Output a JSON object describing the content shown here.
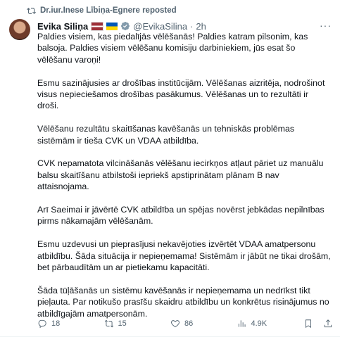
{
  "repost": {
    "text": "Dr.iur.Inese Lībiņa-Egnere reposted"
  },
  "author": {
    "name": "Evika Siliņa",
    "handle": "@EvikaSilina",
    "separator": "·",
    "time": "2h"
  },
  "tweet": {
    "paragraphs": [
      "Paldies visiem, kas piedalījās vēlēšanās! Paldies katram pilsonim, kas balsoja. Paldies visiem vēlēšanu komisiju darbiniekiem, jūs esat šo vēlēšanu varoņi!",
      "Esmu sazinājusies ar drošības institūcijām. Vēlēšanas aizritēja, nodrošinot visus nepieciešamos drošības pasākumus. Vēlēšanas un to rezultāti ir droši.",
      "Vēlēšanu rezultātu skaitīšanas kavēšanās un tehniskās problēmas sistēmām ir tieša CVK un VDAA atbildība.",
      "CVK nepamatota vilcināšanās vēlēšanu iecirkņos atļaut pāriet uz manuālu balsu skaitīšanu atbilstoši iepriekš apstiprinātam plānam B nav attaisnojama.",
      "Arī Saeimai ir jāvērtē CVK atbildība un spējas novērst jebkādas nepilnības pirms nākamajām vēlēšanām.",
      "Esmu uzdevusi un pieprasījusi nekavējoties izvērtēt VDAA amatpersonu atbildību. Šāda situācija ir nepieņemama! Sistēmām ir jābūt ne tikai drošām, bet pārbaudītām un ar pietiekamu kapacitāti.",
      "Šāda tūļāšanās un sistēmu kavēšanās ir nepieņemama un nedrīkst tikt pieļauta. Par notikušo prasīšu skaidru atbildību un konkrētus risinājumus no atbildīgajām amatpersonām."
    ]
  },
  "actions": {
    "replies": "18",
    "reposts": "15",
    "likes": "86",
    "views": "4.9K"
  },
  "icons": {
    "repost": "repost-icon",
    "verified": "verified-badge-icon",
    "more": "more-icon",
    "reply": "reply-icon",
    "like": "heart-icon",
    "views": "views-icon",
    "bookmark": "bookmark-icon",
    "share": "share-icon"
  },
  "colors": {
    "secondary_text": "#536471",
    "primary_text": "#0f1419"
  }
}
